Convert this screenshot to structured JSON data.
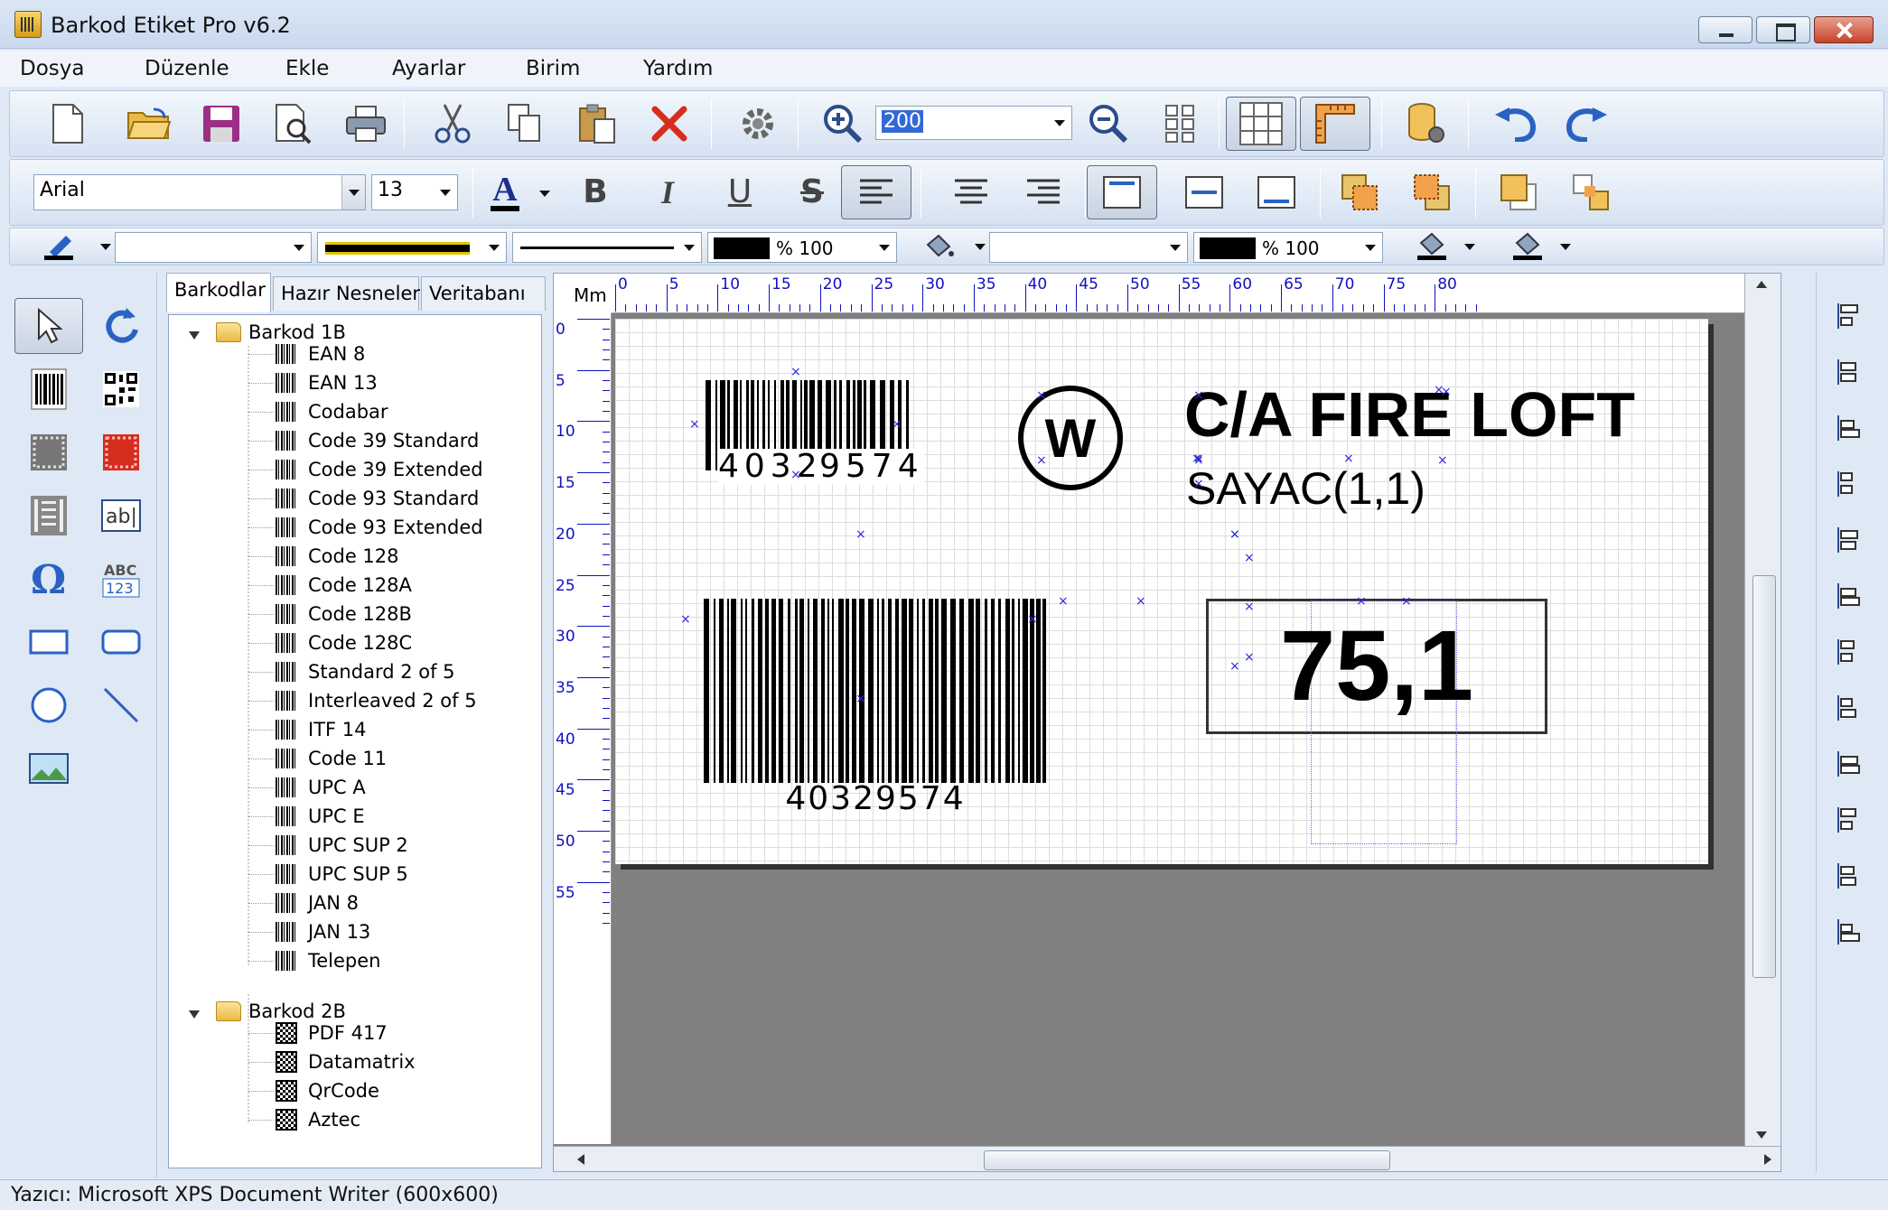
{
  "window": {
    "title": "Barkod Etiket Pro v6.2"
  },
  "menu": [
    "Dosya",
    "Düzenle",
    "Ekle",
    "Ayarlar",
    "Birim",
    "Yardım"
  ],
  "toolbar": {
    "zoom_value": "200"
  },
  "format_toolbar": {
    "font_name": "Arial",
    "font_size": "13",
    "bold_label": "B",
    "italic_label": "I",
    "underline_label": "U",
    "strike_label": "S",
    "text_color_label": "A"
  },
  "style_toolbar": {
    "line_opacity": "% 100",
    "fill_opacity": "% 100"
  },
  "tabs": [
    "Barkodlar",
    "Hazır Nesneler",
    "Veritabanı"
  ],
  "tree": {
    "groups": [
      {
        "name": "Barkod 1B",
        "items": [
          "EAN 8",
          "EAN 13",
          "Codabar",
          "Code 39 Standard",
          "Code 39 Extended",
          "Code 93 Standard",
          "Code 93 Extended",
          "Code 128",
          "Code 128A",
          "Code 128B",
          "Code 128C",
          "Standard 2 of 5",
          "Interleaved 2 of 5",
          "ITF 14",
          "Code 11",
          "UPC A",
          "UPC E",
          "UPC SUP 2",
          "UPC SUP 5",
          "JAN 8",
          "JAN 13",
          "Telepen"
        ]
      },
      {
        "name": "Barkod 2B",
        "items": [
          "PDF 417",
          "Datamatrix",
          "QrCode",
          "Aztec"
        ]
      }
    ]
  },
  "ruler": {
    "unit": "Mm",
    "top_marks": [
      "0",
      "5",
      "10",
      "15",
      "20",
      "25",
      "30",
      "35",
      "40",
      "45",
      "50",
      "55",
      "60",
      "65",
      "70",
      "75",
      "80"
    ],
    "left_marks": [
      "0",
      "5",
      "10",
      "15",
      "20",
      "25",
      "30",
      "35",
      "40",
      "45",
      "50",
      "55"
    ]
  },
  "label": {
    "barcode1_left_digits": "4032",
    "barcode1_right_digits": "9574",
    "logo_letter": "W",
    "title_text": "C/A FIRE LOFT",
    "counter_text": "SAYAC(1,1)",
    "barcode2_text": "40329574",
    "value_text": "75,1"
  },
  "status": {
    "printer": "Yazıcı: Microsoft XPS Document Writer (600x600)"
  },
  "colors": {
    "accent": "#dfe8f5",
    "marker": "#2a2ad8",
    "delete": "#d62d1f"
  }
}
